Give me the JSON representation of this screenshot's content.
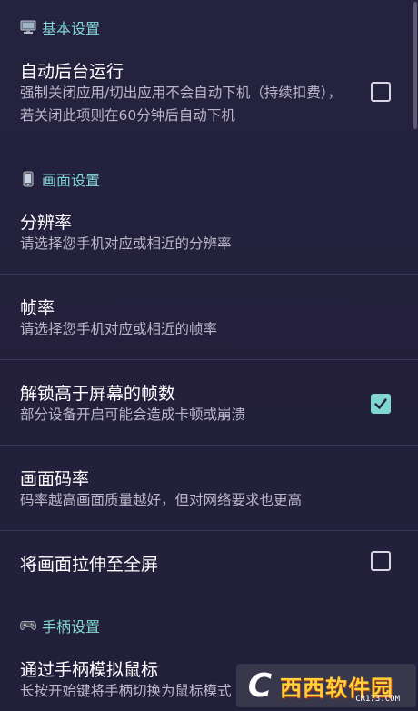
{
  "sections": {
    "basic": {
      "title": "基本设置",
      "icon": "monitor-icon"
    },
    "display": {
      "title": "画面设置",
      "icon": "phone-icon"
    },
    "gamepad": {
      "title": "手柄设置",
      "icon": "gamepad-icon"
    }
  },
  "settings": {
    "background_run": {
      "title": "自动后台运行",
      "desc": "强制关闭应用/切出应用不会自动下机（持续扣费），若关闭此项则在60分钟后自动下机",
      "checked": false
    },
    "resolution": {
      "title": "分辨率",
      "desc": "请选择您手机对应或相近的分辨率"
    },
    "framerate": {
      "title": "帧率",
      "desc": "请选择您手机对应或相近的帧率"
    },
    "unlock_fps": {
      "title": "解锁高于屏幕的帧数",
      "desc": "部分设备开启可能会造成卡顿或崩溃",
      "checked": true
    },
    "bitrate": {
      "title": "画面码率",
      "desc": "码率越高画面质量越好，但对网络要求也更高"
    },
    "stretch": {
      "title": "将画面拉伸至全屏",
      "checked": false
    },
    "gamepad_mouse": {
      "title": "通过手柄模拟鼠标",
      "desc": "长按开始键将手柄切换为鼠标模式"
    }
  },
  "watermark": {
    "logo": "C",
    "text": "西西软件园",
    "sub": "CR173.COM"
  },
  "colors": {
    "background": "#23203c",
    "accent": "#7fd6d2",
    "divider": "#3a3754"
  }
}
